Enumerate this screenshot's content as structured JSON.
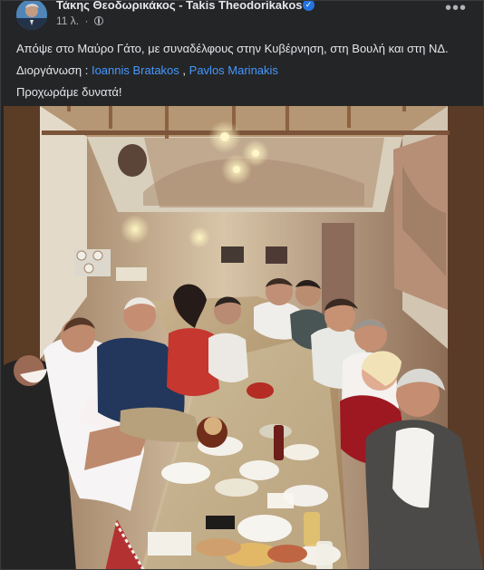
{
  "post": {
    "author": "Τάκης Θεοδωρικάκος - Takis Theodorikakos",
    "time": "11 λ.",
    "dot": "·",
    "more_label": "•••",
    "verified_symbol": "✓",
    "text_line_1": "Απόψε στο Μαύρο Γάτο, με συναδέλφους στην Κυβέρνηση, στη Βουλή και στη ΝΔ.",
    "organizers_label": "Διοργάνωση : ",
    "organizer_1": "Ioannis Bratakos",
    "separator": ", ",
    "organizer_2": "Pavlos Marinakis",
    "text_line_3": "Προχωράμε δυνατά!"
  },
  "icons": {
    "verified": "verified-badge-icon",
    "audience": "globe-icon",
    "more": "more-options-icon"
  },
  "colors": {
    "background": "#242526",
    "text": "#e4e6eb",
    "secondary_text": "#b0b3b8",
    "link": "#4599ff",
    "verified": "#2374e1"
  }
}
